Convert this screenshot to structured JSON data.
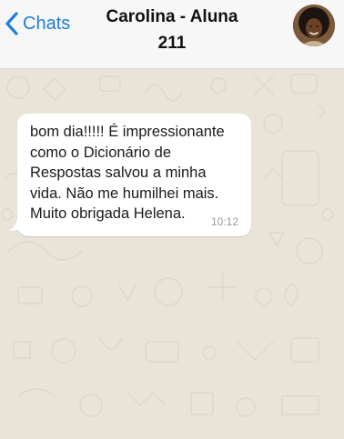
{
  "header": {
    "back_label": "Chats",
    "contact_name": "Carolina - Aluna 211",
    "back_icon": "chevron-left-icon",
    "accent_color": "#1d7fd8"
  },
  "conversation": {
    "messages": [
      {
        "direction": "incoming",
        "text": "bom dia!!!!! É impressionante\ncomo o Dicionário de\nRespostas salvou a minha\nvida. Não me humilhei mais.\nMuito obrigada Helena.",
        "time": "10:12"
      }
    ]
  }
}
